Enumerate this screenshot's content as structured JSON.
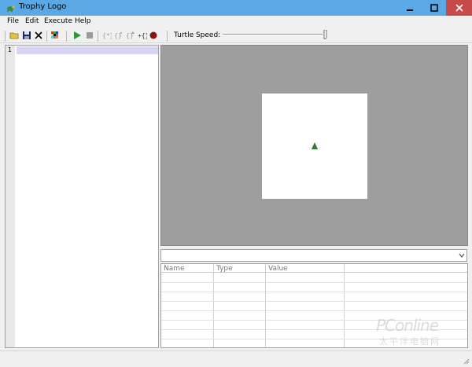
{
  "window": {
    "title": "Trophy Logo",
    "minimize_glyph": "—",
    "maximize_glyph": "❐",
    "close_glyph": "✕"
  },
  "menu": {
    "items": [
      "File",
      "Edit",
      "Execute",
      "Help"
    ]
  },
  "toolbar": {
    "icons": [
      "open-icon",
      "save-icon",
      "close-file-icon",
      "palette-icon",
      "run-icon",
      "stop-icon",
      "step-into-icon",
      "step-over-icon",
      "step-out-icon",
      "breakpoint-toggle-icon",
      "record-icon"
    ],
    "speed_label": "Turtle Speed:"
  },
  "editor": {
    "line_numbers": [
      "1"
    ]
  },
  "variables": {
    "columns": [
      "Name",
      "Type",
      "Value"
    ]
  },
  "watermark": {
    "brand": "PConline",
    "subtitle": "太平洋电脑网"
  },
  "colors": {
    "titlebar": "#5aa9e6",
    "close": "#c74a4a",
    "canvas_bg": "#9e9e9e",
    "turtle": "#2e7d32",
    "current_line": "#d7d5f5"
  }
}
